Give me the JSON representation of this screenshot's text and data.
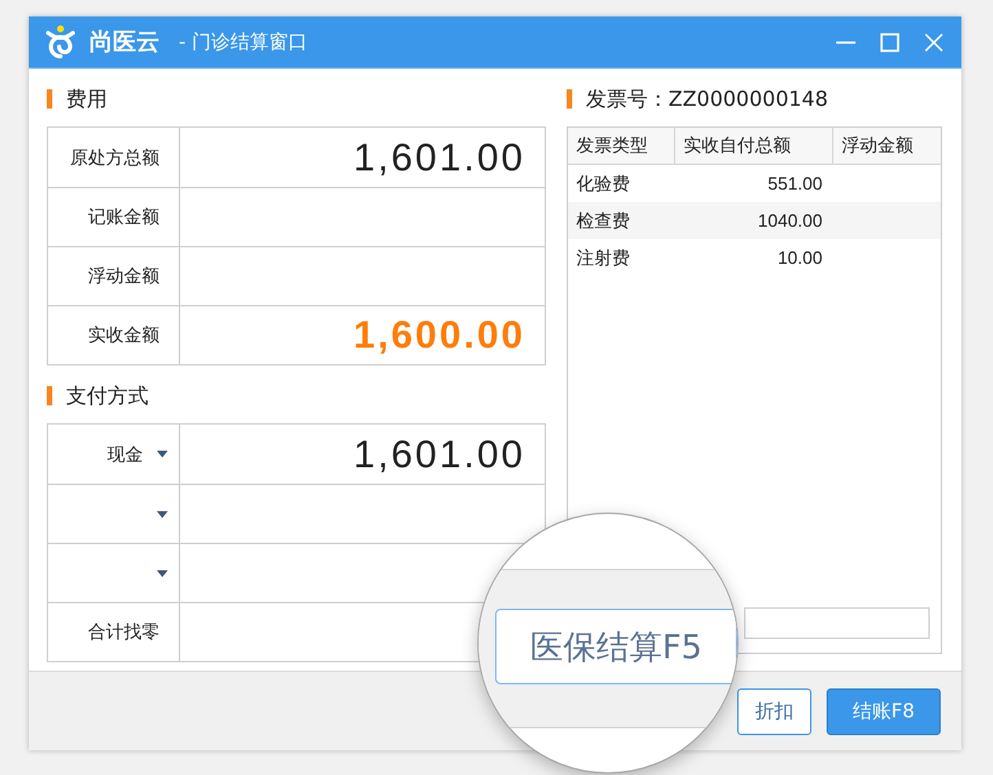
{
  "window": {
    "title": "尚医云",
    "subtitle": "- 门诊结算窗口"
  },
  "fees": {
    "heading": "费用",
    "rows": [
      {
        "label": "原处方总额",
        "value": "1,601.00",
        "kind": "normal"
      },
      {
        "label": "记账金额",
        "kind": "normal"
      },
      {
        "label": "浮动金额",
        "kind": "normal"
      },
      {
        "label": "实收金额",
        "value": "1,600.00",
        "kind": "highlight"
      }
    ]
  },
  "payment": {
    "heading": "支付方式",
    "rows": [
      {
        "kind": "dropdown",
        "label": "现金",
        "value": "1,601.00"
      },
      {
        "kind": "dropdown"
      },
      {
        "kind": "dropdown"
      },
      {
        "kind": "text",
        "label": "合计找零"
      }
    ]
  },
  "invoice": {
    "heading": "发票号：ZZ0000000148",
    "columns": [
      "发票类型",
      "实收自付总额",
      "浮动金额"
    ],
    "rows": [
      {
        "cells": [
          "化验费",
          "551.00"
        ]
      },
      {
        "cells": [
          "检查费",
          "1040.00"
        ]
      },
      {
        "cells": [
          "注射费",
          "10.00"
        ]
      }
    ]
  },
  "footer": {
    "buttons": [
      {
        "label": "折扣",
        "kind": "outline"
      },
      {
        "label": "结账F8",
        "kind": "primary"
      }
    ]
  },
  "magnifier": {
    "button": "医保结算F5"
  }
}
